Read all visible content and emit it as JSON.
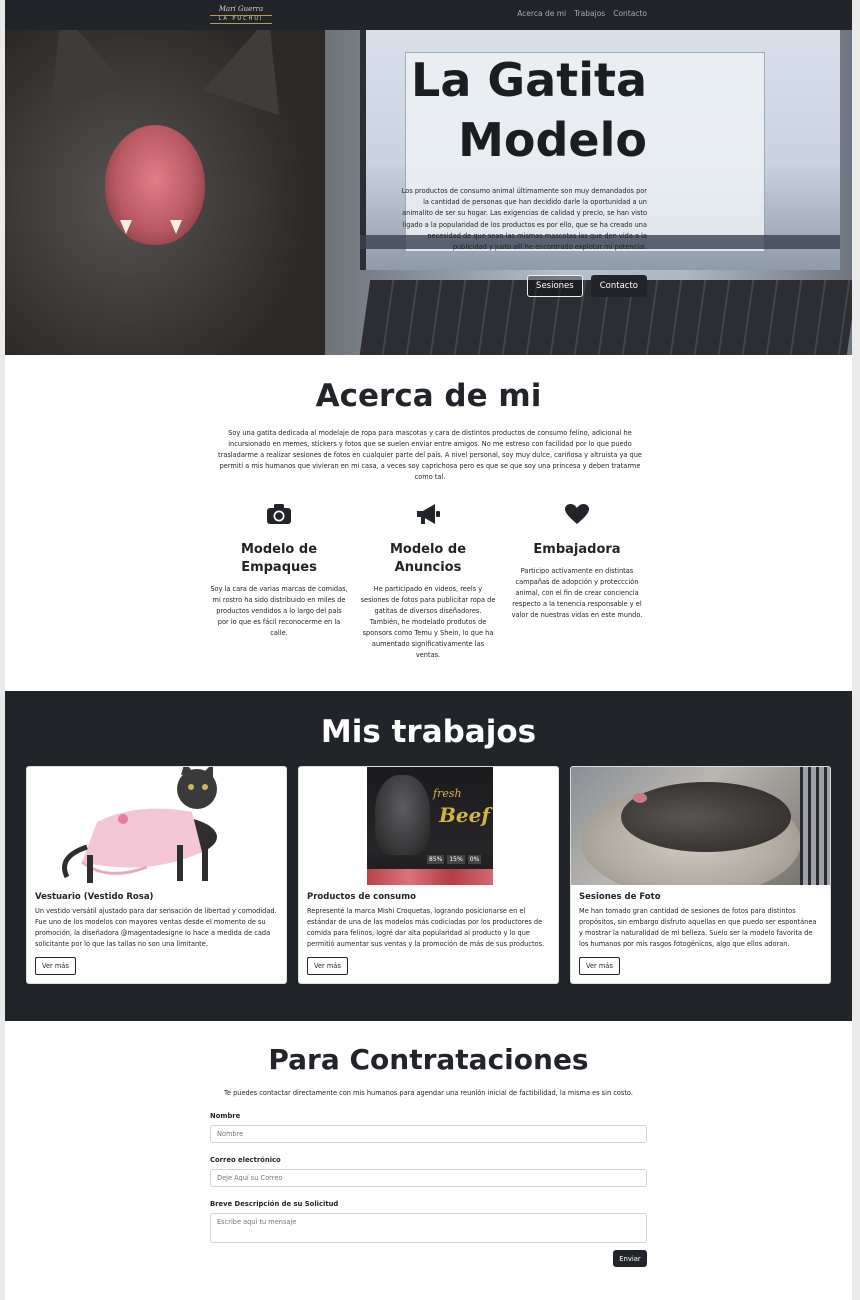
{
  "nav": {
    "logo_script": "Mari Guerra",
    "logo_plate": "LA PUCHUI",
    "links": [
      "Acerca de mi",
      "Trabajos",
      "Contacto"
    ]
  },
  "hero": {
    "title_line1": "La Gatita",
    "title_line2": "Modelo",
    "text": "Los productos de consumo animal últimamente son muy demandados por la cantidad de personas que han decidido darle la oportunidad a un animalito de ser su hogar. Las exigencias de calidad y precio, se han visto ligado a la popularidad de los productos es por ello, que se ha creado una necesidad de que sean las mismas mascotas las que den vida a la publicidad y justo allí he encontrado explotar mi potencial.",
    "btn_sessions": "Sesiones",
    "btn_contact": "Contacto"
  },
  "about": {
    "title": "Acerca de mi",
    "text": "Soy una gatita dedicada al modelaje de ropa para mascotas y cara de distintos productos de consumo felino, adicional he incursionado en memes, stickers y fotos que se suelen enviar entre amigos. No me estreso con facilidad por lo que puedo trasladarme a realizar sesiones de fotos en cualquier parte del país. A nivel personal, soy muy dulce, cariñosa y altruista ya que permití a mis humanos que vivieran en mi casa, a veces soy caprichosa pero es que se que soy una princesa y deben tratarme como tal.",
    "features": [
      {
        "icon": "camera-icon",
        "title": "Modelo de Empaques",
        "text": "Soy la cara de varias marcas de comidas, mi rostro ha sido distribuido en miles de productos vendidos a lo largo del país por lo que es fácil reconocerme en la calle."
      },
      {
        "icon": "megaphone-icon",
        "title": "Modelo de Anuncios",
        "text": "He participado en videos, reels y sesiones de fotos para publicitar ropa de gatitas de diversos diseñadores. También, he modelado produtos de sponsors como Temu y Shein, lo que ha aumentado significativamente las ventas."
      },
      {
        "icon": "heart-icon",
        "title": "Embajadora",
        "text": "Participo activamente en distintas campañas de adopción y proteccción animal, con el fin de crear conciencia respecto a la tenencia responsable y el valor de nuestras vidas en este mundo."
      }
    ]
  },
  "works": {
    "title": "Mis trabajos",
    "cards": [
      {
        "title": "Vestuario (Vestido Rosa)",
        "text": "Un vestido versátil ajustado para dar sensación de libertad y comodidad. Fue uno de los modelos con mayores ventas desde el momento de su promoción, la diseñadora @magentadesigne lo hace a medida de cada solicitante por lo que las tallas no son una limitante.",
        "button": "Ver más"
      },
      {
        "title": "Productos de consumo",
        "text": "Representé la marca Mishi Croquetas, logrando posicionarse en el estándar de una de las modelos más codiciadas por los productores de comida para felinos, logré dar alta popularidad al producto y lo que permitió aumentar sus ventas y la promoción de más de sus productos.",
        "button": "Ver más",
        "package_label1": "fresh",
        "package_label2": "Beef",
        "package_stats": [
          "85%",
          "15%",
          "0%"
        ]
      },
      {
        "title": "Sesiones de Foto",
        "text": "Me han tomado gran cantidad de sesiones de fotos para distintos propósitos, sin embargo disfruto aquellas en que puedo ser espontánea y mostrar la naturalidad de mi belleza. Suelo ser la modelo favorita de los humanos por mis rasgos fotogénicos, algo que ellos adoran.",
        "button": "Ver más"
      }
    ]
  },
  "contact": {
    "title": "Para Contrataciones",
    "intro": "Te puedes contactar directamente con mis humanos para agendar una reunión inicial de factibilidad, la misma es sin costo.",
    "name_label": "Nombre",
    "name_placeholder": "Nombre",
    "email_label": "Correo electrónico",
    "email_placeholder": "Deje Aquí su Correo",
    "message_label": "Breve Descripción de su Solicitud",
    "message_placeholder": "Escribe aquí tu mensaje",
    "submit": "Enviar"
  }
}
